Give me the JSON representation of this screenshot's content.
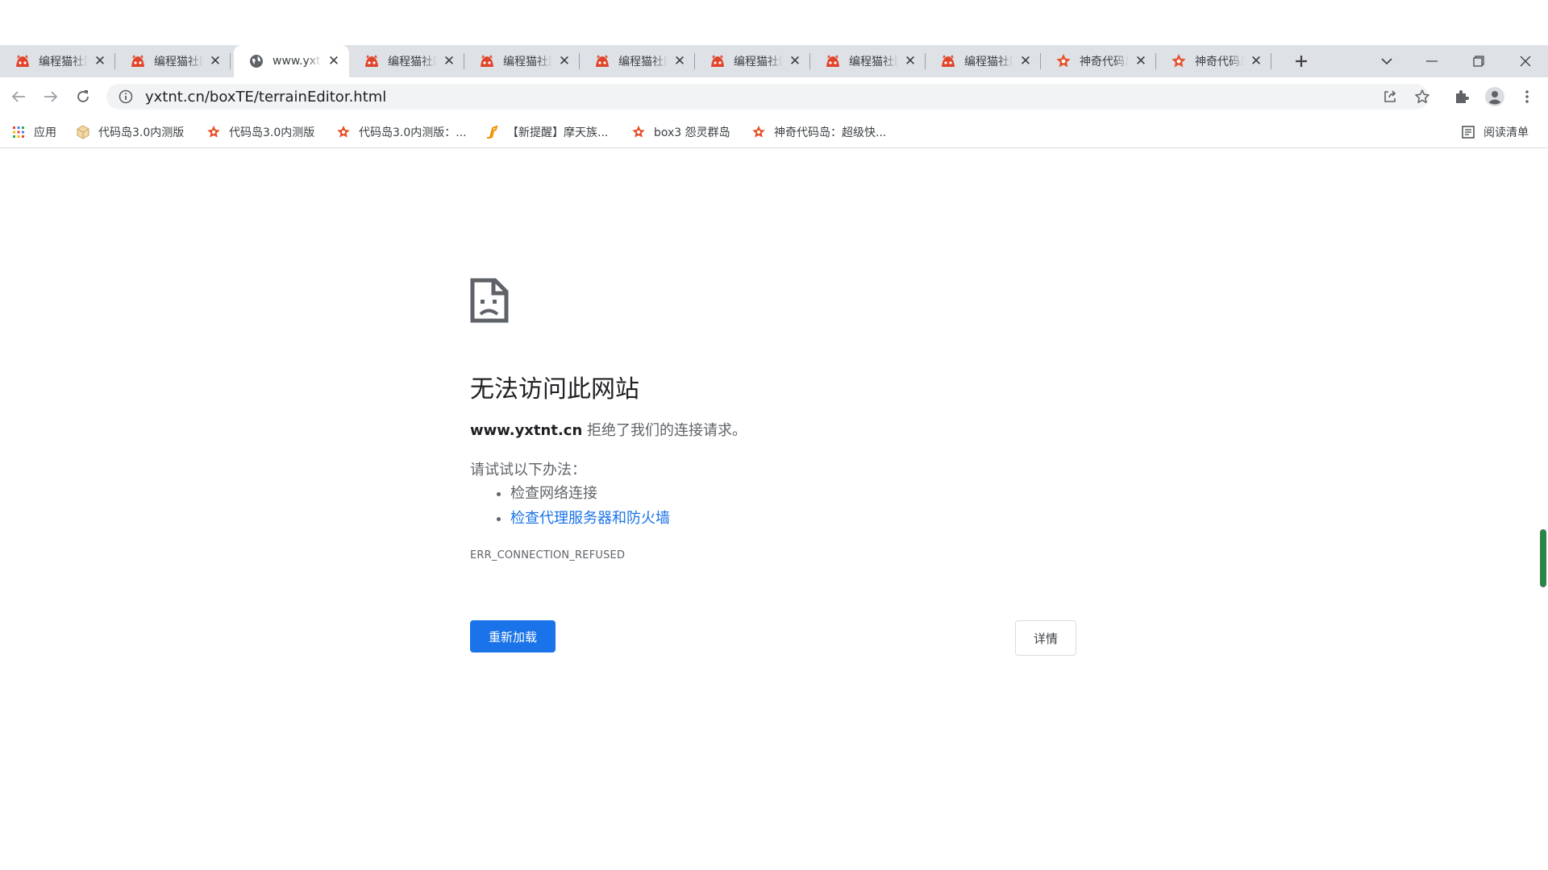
{
  "browser": {
    "tabs": [
      {
        "title": "编程猫社区",
        "icon": "cat-favicon",
        "active": false
      },
      {
        "title": "编程猫社区",
        "icon": "cat-favicon",
        "active": false
      },
      {
        "title": "www.yxtnt.cn",
        "icon": "globe-favicon",
        "active": true
      },
      {
        "title": "编程猫社区",
        "icon": "cat-favicon",
        "active": false
      },
      {
        "title": "编程猫社区",
        "icon": "cat-favicon",
        "active": false
      },
      {
        "title": "编程猫社区",
        "icon": "cat-favicon",
        "active": false
      },
      {
        "title": "编程猫社区",
        "icon": "cat-favicon",
        "active": false
      },
      {
        "title": "编程猫社区",
        "icon": "cat-favicon",
        "active": false
      },
      {
        "title": "编程猫社区",
        "icon": "cat-favicon",
        "active": false
      },
      {
        "title": "神奇代码岛",
        "icon": "star-favicon",
        "active": false
      },
      {
        "title": "神奇代码岛",
        "icon": "star-favicon",
        "active": false
      }
    ],
    "address_bar": {
      "url": "yxtnt.cn/boxTE/terrainEditor.html"
    },
    "bookmarks": [
      {
        "label": "应用",
        "icon": "apps-grid-icon"
      },
      {
        "label": "代码岛3.0内测版",
        "icon": "cube-favicon"
      },
      {
        "label": "代码岛3.0内测版",
        "icon": "star-favicon"
      },
      {
        "label": "代码岛3.0内测版：...",
        "icon": "star-favicon"
      },
      {
        "label": "【新提醒】摩天族...",
        "icon": "orange-logo-favicon"
      },
      {
        "label": "box3 怨灵群岛",
        "icon": "star-favicon"
      },
      {
        "label": "神奇代码岛：超级快...",
        "icon": "star-favicon"
      }
    ],
    "reading_list": "阅读清单"
  },
  "error": {
    "heading": "无法访问此网站",
    "host": "www.yxtnt.cn",
    "message": " 拒绝了我们的连接请求。",
    "try_label": "请试试以下办法：",
    "suggestions": [
      "检查网络连接",
      "检查代理服务器和防火墙"
    ],
    "code": "ERR_CONNECTION_REFUSED",
    "reload_label": "重新加载",
    "details_label": "详情"
  },
  "colors": {
    "accent": "#1a73e8",
    "tabstrip": "#dee1e6",
    "cat_favicon": "#e0452b",
    "star_favicon": "#e8502a"
  }
}
